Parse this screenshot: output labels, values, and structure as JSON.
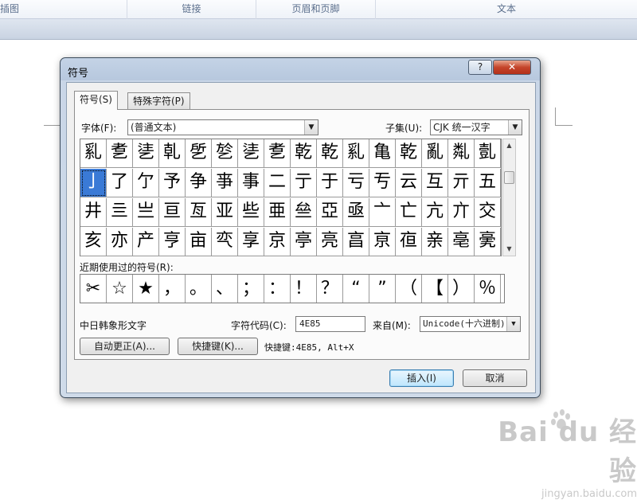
{
  "ribbon": {
    "groups": [
      "插图",
      "链接",
      "页眉和页脚",
      "文本"
    ]
  },
  "dialog": {
    "title": "符号",
    "help_label": "?",
    "close_label": "✕",
    "tabs": [
      {
        "label": "符号(S)",
        "active": true
      },
      {
        "label": "特殊字符(P)",
        "active": false
      }
    ],
    "font": {
      "label": "字体(F):",
      "value": "(普通文本)"
    },
    "subset": {
      "label": "子集(U):",
      "value": "CJK 统一汉字"
    },
    "symbol_grid": {
      "rows": [
        [
          "乿",
          "乽",
          "乼",
          "乹",
          "乺",
          "乻",
          "乼",
          "乽",
          "乾",
          "乾",
          "乿",
          "亀",
          "乾",
          "亂",
          "亃",
          "亄"
        ],
        [
          "亅",
          "了",
          "亇",
          "予",
          "争",
          "亊",
          "事",
          "二",
          "亍",
          "于",
          "亏",
          "亐",
          "云",
          "互",
          "亓",
          "五"
        ],
        [
          "井",
          "亖",
          "亗",
          "亘",
          "亙",
          "亚",
          "些",
          "亜",
          "亝",
          "亞",
          "亟",
          "亠",
          "亡",
          "亢",
          "亣",
          "交"
        ],
        [
          "亥",
          "亦",
          "产",
          "亨",
          "亩",
          "亪",
          "享",
          "京",
          "亭",
          "亮",
          "亯",
          "亰",
          "亱",
          "亲",
          "亳",
          "亴"
        ]
      ],
      "selected": "亅"
    },
    "recent": {
      "label": "近期使用过的符号(R):",
      "symbols": [
        "✂",
        "☆",
        "★",
        "，",
        "。",
        "、",
        "；",
        "：",
        "！",
        "？",
        "“",
        "”",
        "（",
        "【",
        "）",
        "％"
      ]
    },
    "char_name": "中日韩象形文字",
    "char_code": {
      "label": "字符代码(C):",
      "value": "4E85"
    },
    "from": {
      "label": "来自(M):",
      "value": "Unicode(十六进制)"
    },
    "autocorrect_button": "自动更正(A)...",
    "shortcut_button": "快捷键(K)...",
    "shortcut_info": "快捷键:4E85, Alt+X",
    "insert_button": "插入(I)",
    "cancel_button": "取消"
  },
  "watermark": {
    "brand": "Bai du 经验",
    "url": "jingyan.baidu.com"
  }
}
